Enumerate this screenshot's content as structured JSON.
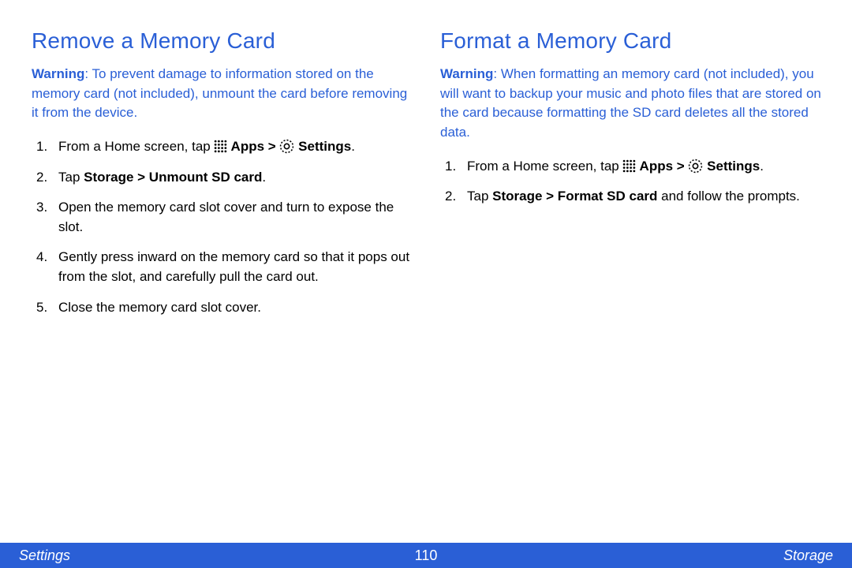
{
  "left": {
    "heading": "Remove a Memory Card",
    "warning_label": "Warning",
    "warning_text": ": To prevent damage to information stored on the memory card (not included), unmount the card before removing it from the device.",
    "steps": {
      "s1_pre": "From a Home screen, tap ",
      "s1_apps": " Apps > ",
      "s1_settings": " Settings",
      "s1_end": ".",
      "s2_pre": "Tap ",
      "s2_bold": "Storage > Unmount SD card",
      "s2_end": ".",
      "s3": "Open the memory card slot cover and turn to expose the slot.",
      "s4": "Gently press inward on the memory card so that it pops out from the slot, and carefully pull the card out.",
      "s5": "Close the memory card slot cover."
    }
  },
  "right": {
    "heading": "Format a Memory Card",
    "warning_label": "Warning",
    "warning_text": ": When formatting an memory card (not included), you will want to backup your music and photo files that are stored on the card because formatting the SD card deletes all the stored data.",
    "steps": {
      "s1_pre": "From a Home screen, tap ",
      "s1_apps": " Apps > ",
      "s1_settings": " Settings",
      "s1_end": ".",
      "s2_pre": "Tap ",
      "s2_bold": "Storage > Format SD card",
      "s2_post": " and follow the prompts."
    }
  },
  "footer": {
    "left": "Settings",
    "page": "110",
    "right": "Storage"
  }
}
